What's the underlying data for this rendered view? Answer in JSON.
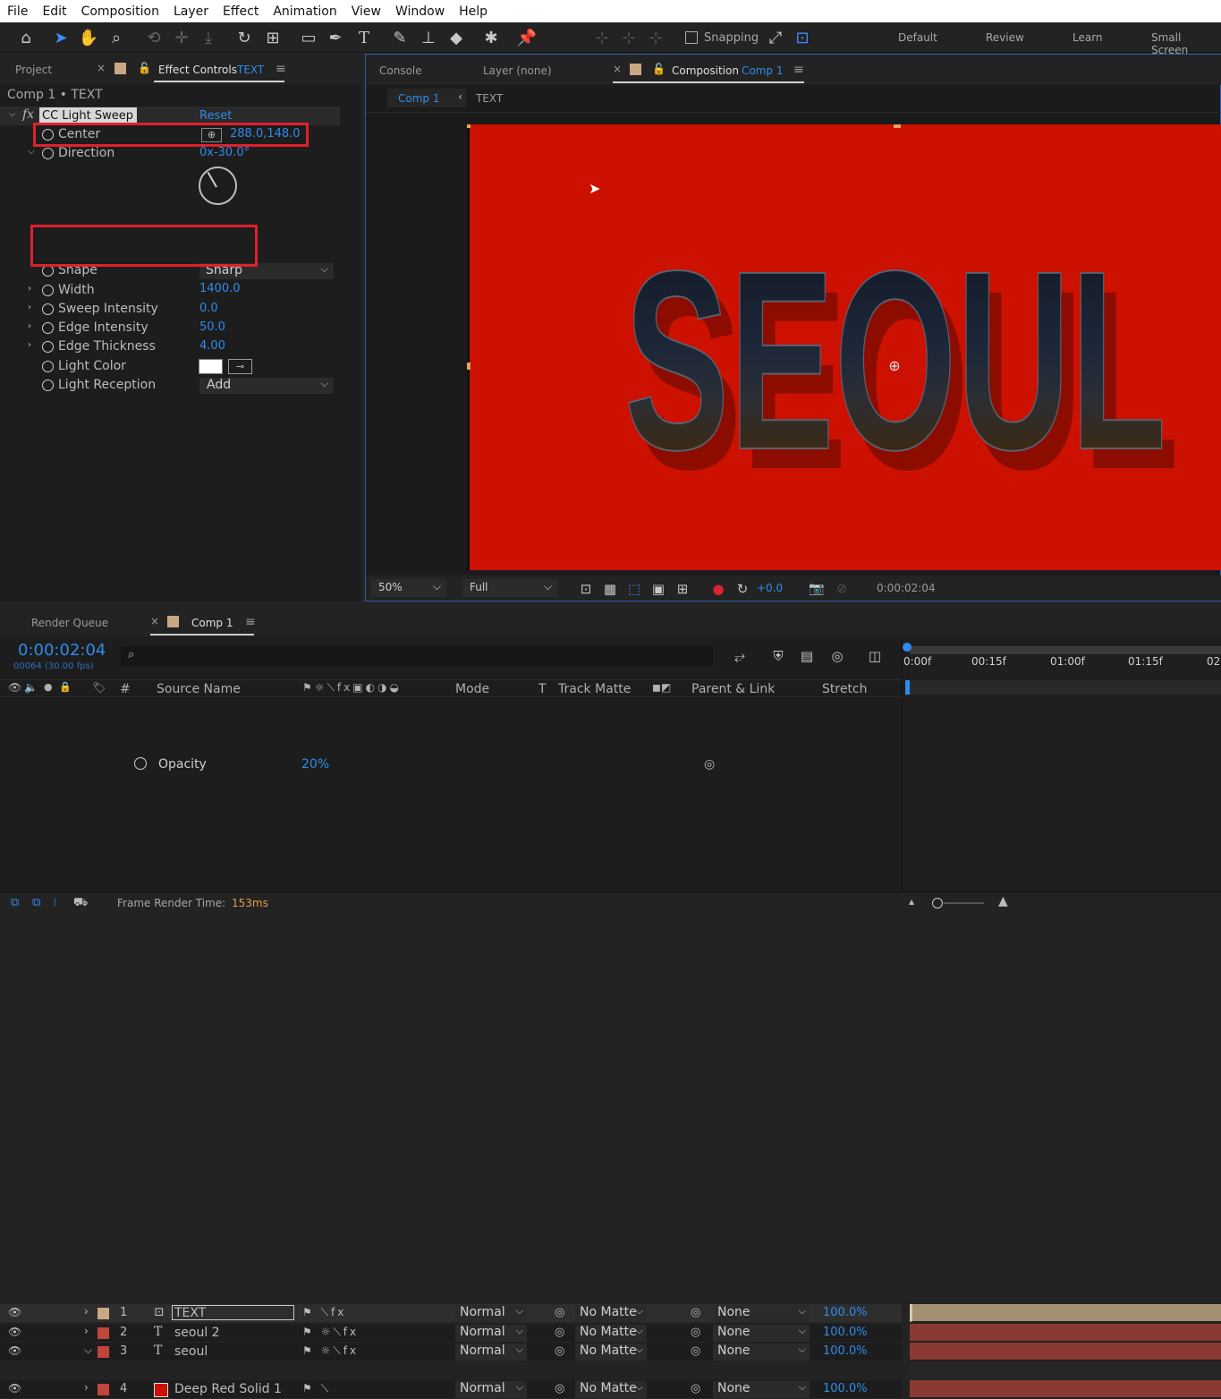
{
  "menu": [
    "File",
    "Edit",
    "Composition",
    "Layer",
    "Effect",
    "Animation",
    "View",
    "Window",
    "Help"
  ],
  "toolbar": {
    "snapping": "Snapping",
    "workspaces": [
      "Default",
      "Review",
      "Learn",
      "Small Screen"
    ]
  },
  "left_panel": {
    "tab_project": "Project",
    "tab_effect": "Effect Controls",
    "tab_effect_layer": "TEXT",
    "breadcrumb": "Comp 1 • TEXT",
    "fx_label": "fx",
    "effect_name": "CC Light Sweep",
    "reset": "Reset",
    "props": [
      {
        "label": "Center",
        "value": "288.0,148.0"
      },
      {
        "label": "Direction",
        "value": "0x-30.0°"
      },
      {
        "label": "Shape",
        "value": "Sharp"
      },
      {
        "label": "Width",
        "value": "1400.0"
      },
      {
        "label": "Sweep Intensity",
        "value": "0.0"
      },
      {
        "label": "Edge Intensity",
        "value": "50.0"
      },
      {
        "label": "Edge Thickness",
        "value": "4.00"
      },
      {
        "label": "Light Color",
        "value": ""
      },
      {
        "label": "Light Reception",
        "value": "Add"
      }
    ]
  },
  "comp_panel": {
    "tab_console": "Console",
    "tab_layer": "Layer (none)",
    "tab_comp": "Composition",
    "tab_comp_name": "Comp 1",
    "sub_comp": "Comp 1",
    "sub_text": "TEXT",
    "headline": "SEOUL",
    "zoom": "50%",
    "resolution": "Full",
    "exposure": "+0.0",
    "timecode": "0:00:02:04",
    "bg_color": "#cc1100"
  },
  "timeline": {
    "tab_render": "Render Queue",
    "tab_comp": "Comp 1",
    "timecode": "0:00:02:04",
    "frames": "00064 (30.00 fps)",
    "search_placeholder": "",
    "headers": {
      "num": "#",
      "source": "Source Name",
      "mode": "Mode",
      "t": "T",
      "track_matte": "Track Matte",
      "parent": "Parent & Link",
      "stretch": "Stretch"
    },
    "ruler": [
      "0:00f",
      "00:15f",
      "01:00f",
      "01:15f",
      "02:"
    ],
    "layers": [
      {
        "num": "1",
        "name": "TEXT",
        "mode": "Normal",
        "matte": "No Matte",
        "parent": "None",
        "stretch": "100.0%",
        "label": "#c8a882"
      },
      {
        "num": "2",
        "name": "seoul 2",
        "mode": "Normal",
        "matte": "No Matte",
        "parent": "None",
        "stretch": "100.0%",
        "label": "#c0453c"
      },
      {
        "num": "3",
        "name": "seoul",
        "mode": "Normal",
        "matte": "No Matte",
        "parent": "None",
        "stretch": "100.0%",
        "label": "#c0453c"
      },
      {
        "num": "4",
        "name": "Deep Red Solid 1",
        "mode": "Normal",
        "matte": "No Matte",
        "parent": "None",
        "stretch": "100.0%",
        "label": "#c0453c"
      }
    ],
    "opacity_label": "Opacity",
    "opacity_value": "20%",
    "footer_label": "Frame Render Time:",
    "footer_value": "153ms"
  }
}
